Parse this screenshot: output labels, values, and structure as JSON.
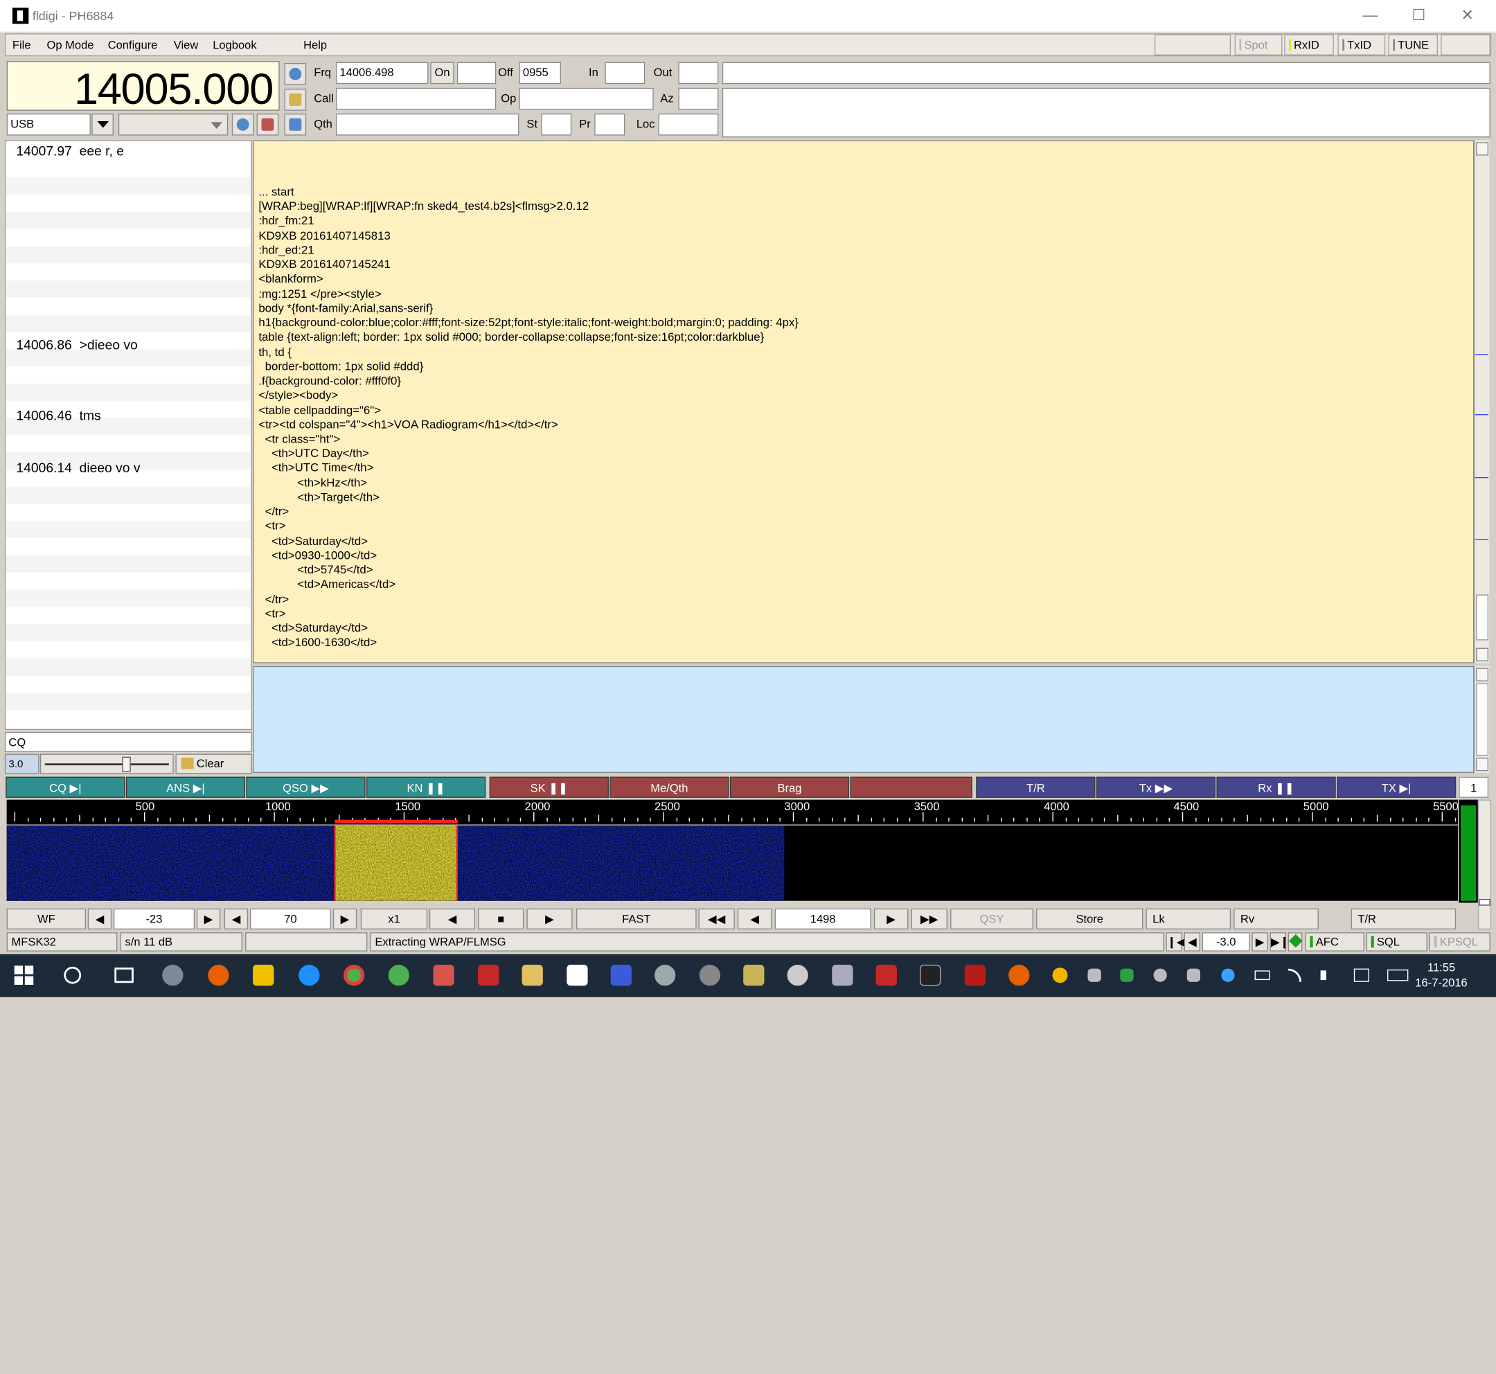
{
  "window": {
    "title": "fldigi - PH6884",
    "minimize": "—",
    "maximize": "☐",
    "close": "✕"
  },
  "menu": {
    "file": "File",
    "opmode": "Op Mode",
    "configure": "Configure",
    "view": "View",
    "logbook": "Logbook",
    "help": "Help"
  },
  "toolbar": {
    "spot": "Spot",
    "rxid": "RxID",
    "txid": "TxID",
    "tune": "TUNE"
  },
  "frequency": {
    "display": "14005.000"
  },
  "mode": {
    "value": "USB"
  },
  "log": {
    "frq_label": "Frq",
    "frq_value": "14006.498",
    "on_label": "On",
    "on_value": "",
    "off_label": "Off",
    "off_value": "0955",
    "in_label": "In",
    "in_value": "",
    "out_label": "Out",
    "out_value": "",
    "call_label": "Call",
    "call_value": "",
    "op_label": "Op",
    "op_value": "",
    "az_label": "Az",
    "az_value": "",
    "qth_label": "Qth",
    "qth_value": "",
    "st_label": "St",
    "st_value": "",
    "pr_label": "Pr",
    "pr_value": "",
    "loc_label": "Loc",
    "loc_value": ""
  },
  "browser": {
    "entries": [
      {
        "freq": "14007.97",
        "text": "eee r,  e"
      },
      {
        "freq": "14006.86",
        "text": ">dieeo vo"
      },
      {
        "freq": "14006.46",
        "text": "tms"
      },
      {
        "freq": "14006.14",
        "text": "dieeo vo v"
      }
    ],
    "search": "CQ",
    "squelch": "3.0",
    "clear": "Clear"
  },
  "rx_text": "... start\n[WRAP:beg][WRAP:lf][WRAP:fn sked4_test4.b2s]<flmsg>2.0.12\n:hdr_fm:21\nKD9XB 20161407145813\n:hdr_ed:21\nKD9XB 20161407145241\n<blankform>\n:mg:1251 </pre><style>\nbody *{font-family:Arial,sans-serif}\nh1{background-color:blue;color:#fff;font-size:52pt;font-style:italic;font-weight:bold;margin:0; padding: 4px}\ntable {text-align:left; border: 1px solid #000; border-collapse:collapse;font-size:16pt;color:darkblue}\nth, td {\n  border-bottom: 1px solid #ddd}\n.f{background-color: #fff0f0}\n</style><body>\n<table cellpadding=\"6\">\n<tr><td colspan=\"4\"><h1>VOA Radiogram</h1></td></tr>\n  <tr class=\"ht\">\n    <th>UTC Day</th>\n    <th>UTC Time</th>\n            <th>kHz</th>\n            <th>Target</th>\n  </tr>\n  <tr>\n    <td>Saturday</td>\n    <td>0930-1000</td>\n            <td>5745</td>\n            <td>Americas</td>\n  </tr>\n  <tr>\n    <td>Saturday</td>\n    <td>1600-1630</td>",
  "macros": [
    {
      "label": "CQ ▶|",
      "color": "#2f8f8f"
    },
    {
      "label": "ANS ▶|",
      "color": "#2f8f8f"
    },
    {
      "label": "QSO ▶▶",
      "color": "#2f8f8f"
    },
    {
      "label": "KN ❚❚",
      "color": "#2f8f8f"
    },
    {
      "label": "SK ❚❚",
      "color": "#9b4444"
    },
    {
      "label": "Me/Qth",
      "color": "#9b4444"
    },
    {
      "label": "Brag",
      "color": "#9b4444"
    },
    {
      "label": "",
      "color": "#9b4444"
    },
    {
      "label": "T/R",
      "color": "#46468f"
    },
    {
      "label": "Tx ▶▶",
      "color": "#46468f"
    },
    {
      "label": "Rx ❚❚",
      "color": "#46468f"
    },
    {
      "label": "TX ▶|",
      "color": "#46468f"
    }
  ],
  "macro_set": "1",
  "scale": [
    "500",
    "1000",
    "1500",
    "2000",
    "2500",
    "3000",
    "3500",
    "4000",
    "4500",
    "5000",
    "5500"
  ],
  "wf_controls": {
    "wf": "WF",
    "ref": "-23",
    "range": "70",
    "zoom": "x1",
    "speed": "FAST",
    "carrier": "1498",
    "qsy": "QSY",
    "store": "Store",
    "lk": "Lk",
    "rv": "Rv",
    "tr": "T/R"
  },
  "statusbar": {
    "mode": "MFSK32",
    "sn": "s/n  11 dB",
    "blank": "",
    "message": "Extracting WRAP/FLMSG",
    "afc_value": "-3.0",
    "afc": "AFC",
    "sql": "SQL",
    "kpsql": "KPSQL"
  },
  "clock": {
    "time": "11:55",
    "date": "16-7-2016"
  },
  "colors": {
    "rx_bg": "#fff0c0",
    "tx_bg": "#cde8fb",
    "freq_bg": "#fffce0",
    "wf_blue": "#1a2ec8",
    "wf_yellow": "#f5e83a"
  }
}
